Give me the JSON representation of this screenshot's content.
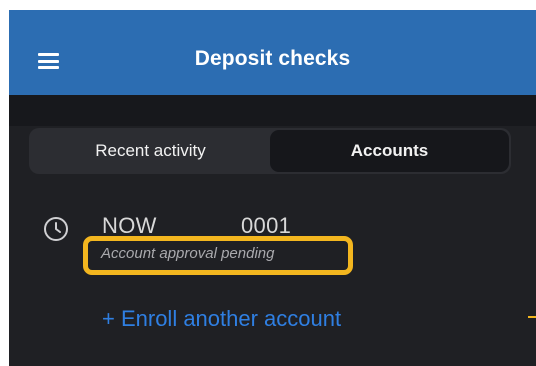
{
  "header": {
    "title": "Deposit checks",
    "background": "#2c6db2"
  },
  "tabs": [
    {
      "label": "Recent activity",
      "selected": false
    },
    {
      "label": "Accounts",
      "selected": true
    }
  ],
  "account": {
    "icon": "clock-icon",
    "name": "NOW",
    "number": "0001",
    "status": "Account approval pending"
  },
  "enroll": {
    "label": "+ Enroll another account",
    "color": "#2f7fe2"
  },
  "highlight_color": "#f3b61f"
}
